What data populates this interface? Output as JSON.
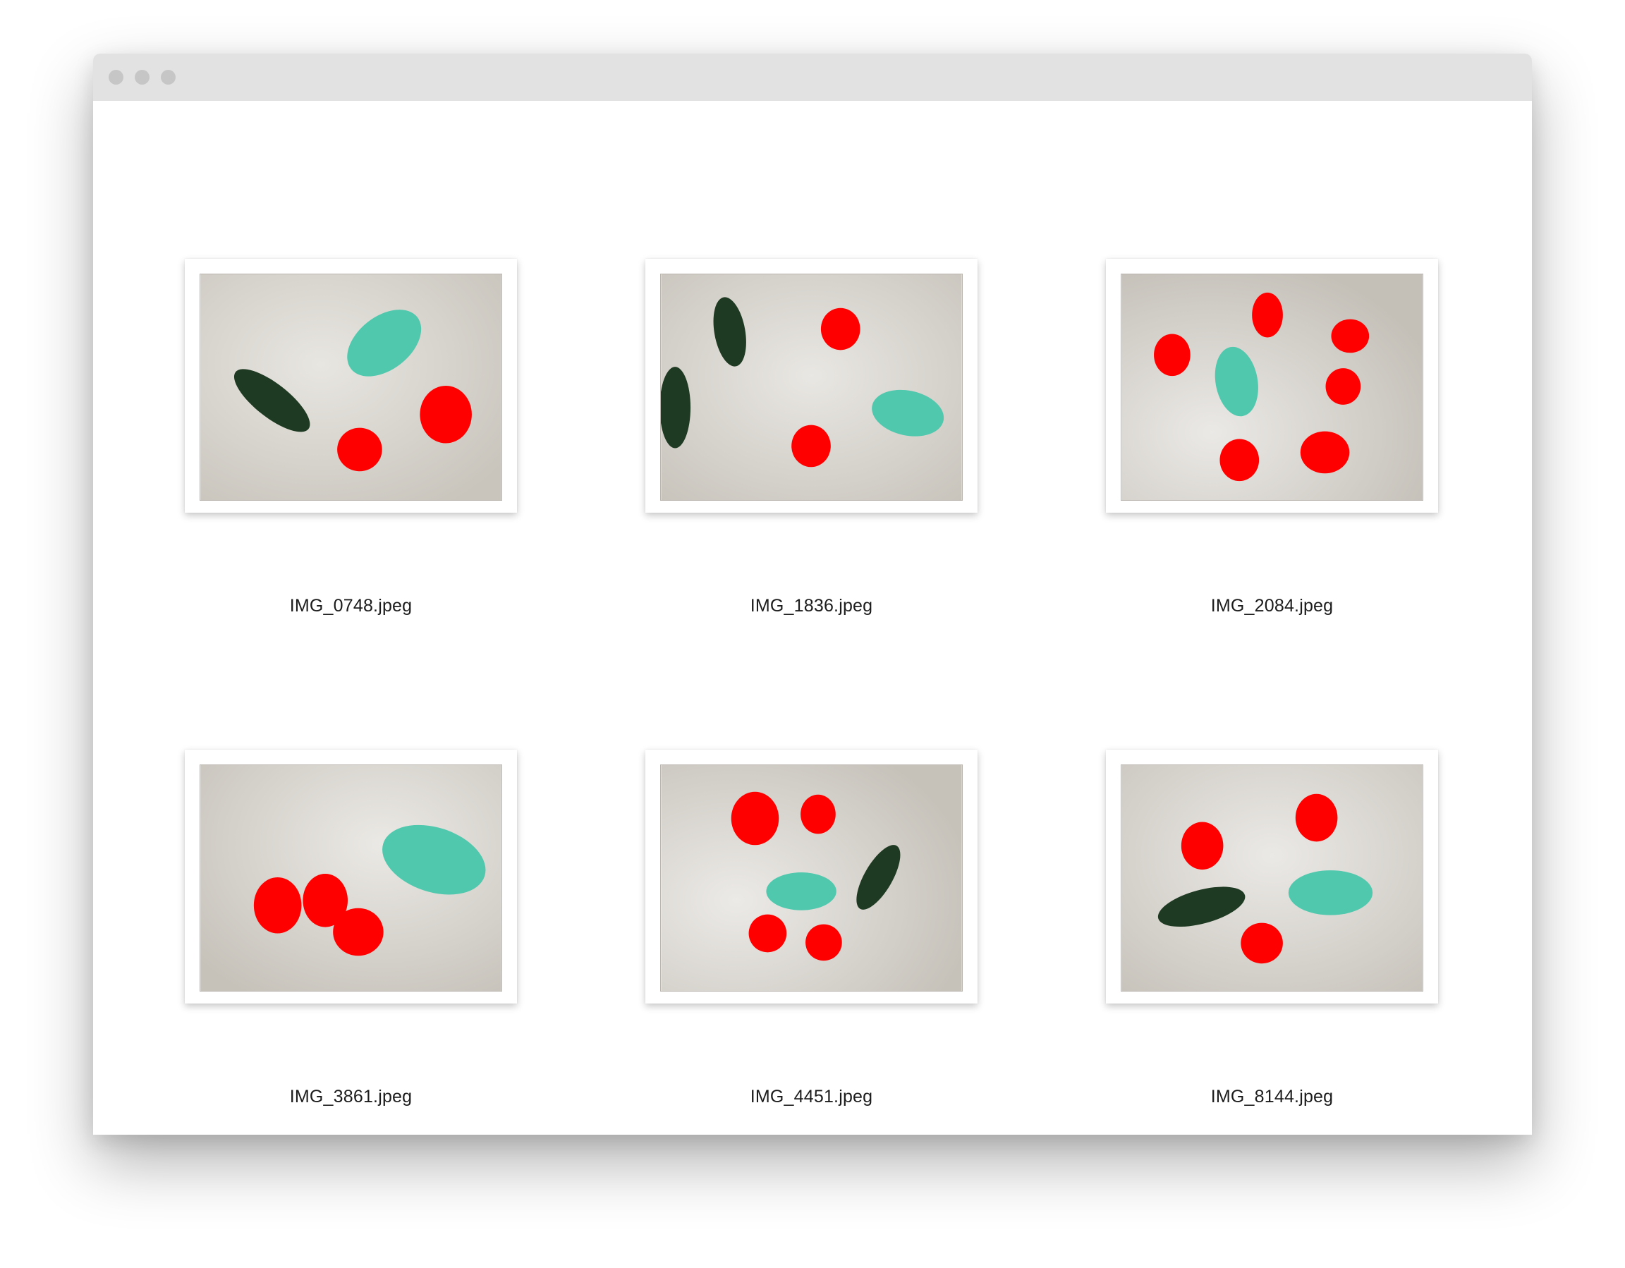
{
  "window": {
    "controls": [
      "close-dot",
      "minimize-dot",
      "zoom-dot"
    ]
  },
  "files": [
    {
      "name": "IMG_0748.jpeg"
    },
    {
      "name": "IMG_1836.jpeg"
    },
    {
      "name": "IMG_2084.jpeg"
    },
    {
      "name": "IMG_3861.jpeg"
    },
    {
      "name": "IMG_4451.jpeg"
    },
    {
      "name": "IMG_8144.jpeg"
    }
  ],
  "colors": {
    "tomato_mask": "#ff0000",
    "lemon_mask": "#50c8ae",
    "cucumber": "#1f3a22",
    "table": "#d6d3cd"
  }
}
